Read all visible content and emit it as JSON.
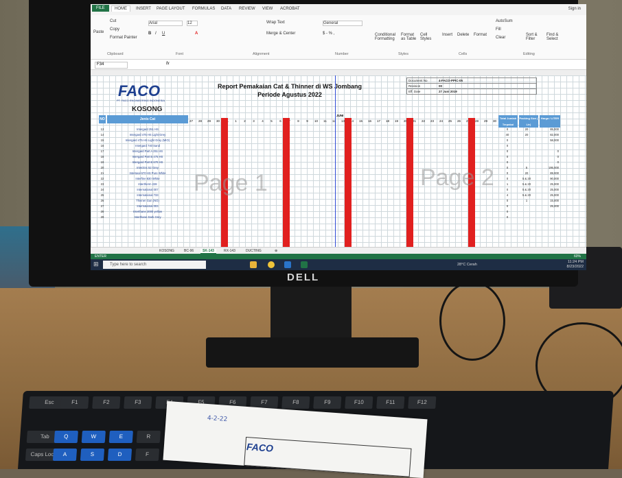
{
  "ribbon": {
    "tabs": [
      "FILE",
      "HOME",
      "INSERT",
      "PAGE LAYOUT",
      "FORMULAS",
      "DATA",
      "REVIEW",
      "VIEW",
      "ACROBAT"
    ],
    "signin": "Sign in",
    "clipboard": {
      "paste": "Paste",
      "cut": "Cut",
      "copy": "Copy",
      "format_painter": "Format Painter",
      "label": "Clipboard"
    },
    "font": {
      "name": "Arial",
      "size": "12",
      "label": "Font"
    },
    "alignment": {
      "wrap": "Wrap Text",
      "merge": "Merge & Center",
      "label": "Alignment"
    },
    "number": {
      "format": "General",
      "label": "Number"
    },
    "styles": {
      "conditional": "Conditional Formatting",
      "format_table": "Format as Table",
      "cell_styles": "Cell Styles",
      "label": "Styles"
    },
    "cells": {
      "insert": "Insert",
      "delete": "Delete",
      "format": "Format",
      "label": "Cells"
    },
    "editing": {
      "autosum": "AutoSum",
      "fill": "Fill",
      "clear": "Clear",
      "sort": "Sort & Filter",
      "find": "Find & Select",
      "label": "Editing"
    }
  },
  "formula_bar": {
    "cell": "F34",
    "fx": "fx"
  },
  "sheet": {
    "logo": "FACO",
    "logo_sub": "PT. FACO ENGINEERING INDONESIA",
    "kosong": "KOSONG",
    "title_line1": "Report Pemakaian Cat & Thinner di WS Jombang",
    "title_line2": "Periode Agustus 2022",
    "doc_info": [
      {
        "label": "Document No",
        "value": "4-FACO-PPIC-05"
      },
      {
        "label": "Revision",
        "value": "00"
      },
      {
        "label": "Eff. Date",
        "value": "27 Juni 2019"
      }
    ],
    "headers": {
      "no": "NO",
      "jenis": "Jenis Cat",
      "total": "Total Jumlah Terpakai",
      "packing": "Packing Size ( Ltr)",
      "harga": "Harga / LITER"
    },
    "juni_label": "JUNI",
    "days": [
      "27",
      "28",
      "29",
      "30",
      "31",
      "1",
      "2",
      "3",
      "4",
      "5",
      "6",
      "7",
      "8",
      "9",
      "10",
      "11",
      "12",
      "13",
      "14",
      "15",
      "16",
      "17",
      "18",
      "19",
      "20",
      "21",
      "22",
      "23",
      "24",
      "25",
      "26",
      "27",
      "28",
      "29",
      "30"
    ],
    "watermark_left": "Page 1",
    "watermark_right": "Page 2",
    "rows": [
      {
        "no": "13",
        "name": "Intergard 251 HS",
        "tot": "0",
        "pack": "20",
        "price": "85,000"
      },
      {
        "no": "14",
        "name": "Intergard 475 HS Light Grey",
        "tot": "40",
        "pack": "20",
        "price": "82,000"
      },
      {
        "no": "15",
        "name": "Intergard 475 HS Light Grey (MIO)",
        "tot": "0",
        "pack": "",
        "price": "58,000"
      },
      {
        "no": "16",
        "name": "Intergard 740 Sand",
        "tot": "0",
        "pack": "",
        "price": ""
      },
      {
        "no": "17",
        "name": "Intergard Part A 251 HS",
        "tot": "0",
        "pack": "",
        "price": "0"
      },
      {
        "no": "18",
        "name": "Intergard Part B 475 HS",
        "tot": "0",
        "pack": "",
        "price": "0"
      },
      {
        "no": "19",
        "name": "Intergard Part B 670 HS",
        "tot": "0",
        "pack": "",
        "price": "0"
      },
      {
        "no": "20",
        "name": "Interzinc 52 Grey",
        "tot": "0",
        "pack": "5",
        "price": "195,000"
      },
      {
        "no": "21",
        "name": "Interseal 670 HS Pure White",
        "tot": "0",
        "pack": "20",
        "price": "89,000"
      },
      {
        "no": "22",
        "name": "Interfine 830 White",
        "tot": "0",
        "pack": "5 & 20",
        "price": "90,000"
      },
      {
        "no": "23",
        "name": "Intertherm 228",
        "tot": "1",
        "pack": "5 & 20",
        "price": "25,000"
      },
      {
        "no": "24",
        "name": "International 007",
        "tot": "0",
        "pack": "5 & 20",
        "price": "25,000"
      },
      {
        "no": "25",
        "name": "International 733",
        "tot": "4",
        "pack": "5 & 20",
        "price": "25,000"
      },
      {
        "no": "26",
        "name": "Thinner Gun (NO)",
        "tot": "0",
        "pack": "1",
        "price": "15,000"
      },
      {
        "no": "27",
        "name": "International 003",
        "tot": "0",
        "pack": "",
        "price": "25,000"
      },
      {
        "no": "28",
        "name": "Interthane 2000 yellow",
        "tot": "0",
        "pack": "",
        "price": ""
      },
      {
        "no": "29",
        "name": "Interthane Dark Grey",
        "tot": "0",
        "pack": "",
        "price": ""
      }
    ]
  },
  "sheet_tabs": [
    "KOSONG",
    "BC-96",
    "SK-143",
    "RX-143",
    "DUCTING"
  ],
  "active_sheet": "SK-143",
  "status": {
    "mode": "ENTER",
    "zoom": "60%"
  },
  "taskbar": {
    "search": "Type here to search",
    "weather": "28°C Cerah",
    "time": "11:24 PM",
    "date": "8/23/2022"
  },
  "monitor_brand": "DELL",
  "paper": {
    "note": "4-2-22",
    "logo": "FACO"
  },
  "keyboard": {
    "row1": [
      "Esc",
      "F1",
      "F2",
      "F3",
      "F4",
      "F5",
      "F6",
      "F7",
      "F8",
      "F9",
      "F10",
      "F11",
      "F12"
    ],
    "row3": [
      "Tab",
      "Q",
      "W",
      "E",
      "R",
      "T"
    ],
    "row4": [
      "Caps Lock",
      "A",
      "S",
      "D",
      "F",
      "G"
    ]
  },
  "colors": {
    "excel_green": "#217346",
    "header_blue": "#5b9bd5",
    "red_column": "#e1201f"
  }
}
